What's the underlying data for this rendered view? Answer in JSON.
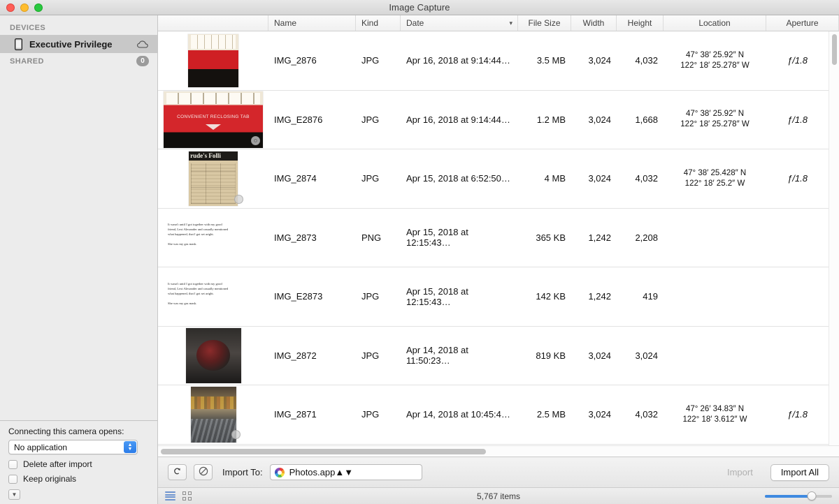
{
  "window": {
    "title": "Image Capture"
  },
  "sidebar": {
    "devices_header": "DEVICES",
    "devices": [
      {
        "label": "Executive Privilege",
        "icon": "iphone-icon",
        "trailing_icon": "cloud-icon",
        "selected": true
      }
    ],
    "shared_header": "SHARED",
    "shared_count": "0",
    "options": {
      "connect_label": "Connecting this camera opens:",
      "application_value": "No application",
      "delete_after_import": "Delete after import",
      "keep_originals": "Keep originals"
    }
  },
  "table": {
    "columns": [
      {
        "key": "thumb",
        "label": ""
      },
      {
        "key": "name",
        "label": "Name"
      },
      {
        "key": "kind",
        "label": "Kind"
      },
      {
        "key": "date",
        "label": "Date",
        "sort": "descending",
        "sort_icon": "chevron-down-icon"
      },
      {
        "key": "filesize",
        "label": "File Size"
      },
      {
        "key": "width",
        "label": "Width"
      },
      {
        "key": "height",
        "label": "Height"
      },
      {
        "key": "location",
        "label": "Location"
      },
      {
        "key": "aperture",
        "label": "Aperture"
      }
    ],
    "rows": [
      {
        "name": "IMG_2876",
        "kind": "JPG",
        "date": "Apr 16, 2018 at 9:14:44…",
        "filesize": "3.5 MB",
        "width": "3,024",
        "height": "4,032",
        "location_lat": "47° 38′ 25.92″ N",
        "location_lon": "122° 18′ 25.278″ W",
        "aperture": "ƒ/1.8",
        "thumb": "box-red-tall"
      },
      {
        "name": "IMG_E2876",
        "kind": "JPG",
        "date": "Apr 16, 2018 at 9:14:44…",
        "filesize": "1.2 MB",
        "width": "3,024",
        "height": "1,668",
        "location_lat": "47° 38′ 25.92″ N",
        "location_lon": "122° 18′ 25.278″ W",
        "aperture": "ƒ/1.8",
        "thumb": "box-red-wide",
        "thumb_caption": "CONVENIENT RECLOSING TAB",
        "edited_badge": true
      },
      {
        "name": "IMG_2874",
        "kind": "JPG",
        "date": "Apr 15, 2018 at 6:52:50…",
        "filesize": "4 MB",
        "width": "3,024",
        "height": "4,032",
        "location_lat": "47° 38′ 25.428″ N",
        "location_lon": "122° 18′ 25.2″ W",
        "aperture": "ƒ/1.8",
        "thumb": "comic-newspaper",
        "thumb_caption": "rude's Folli",
        "edited_badge": true
      },
      {
        "name": "IMG_2873",
        "kind": "PNG",
        "date": "Apr 15, 2018 at 12:15:43…",
        "filesize": "365 KB",
        "width": "1,242",
        "height": "2,208",
        "location_lat": "",
        "location_lon": "",
        "aperture": "",
        "thumb": "text-screenshot",
        "thumb_text_1": "It wasn't until I got together with my good",
        "thumb_text_2": "friend, Lexi Alexander and casually mentioned",
        "thumb_text_3": "what happened, that I got set aright.",
        "thumb_text_4": "She was my gas mask."
      },
      {
        "name": "IMG_E2873",
        "kind": "JPG",
        "date": "Apr 15, 2018 at 12:15:43…",
        "filesize": "142 KB",
        "width": "1,242",
        "height": "419",
        "location_lat": "",
        "location_lon": "",
        "aperture": "",
        "thumb": "text-screenshot",
        "thumb_text_1": "It wasn't until I got together with my good",
        "thumb_text_2": "friend, Lexi Alexander and casually mentioned",
        "thumb_text_3": "what happened, that I got set aright.",
        "thumb_text_4": "She was my gas mask."
      },
      {
        "name": "IMG_2872",
        "kind": "JPG",
        "date": "Apr 14, 2018 at 11:50:23…",
        "filesize": "819 KB",
        "width": "3,024",
        "height": "3,024",
        "location_lat": "",
        "location_lon": "",
        "aperture": "",
        "thumb": "gas-mask-photo"
      },
      {
        "name": "IMG_2871",
        "kind": "JPG",
        "date": "Apr 14, 2018 at 10:45:4…",
        "filesize": "2.5 MB",
        "width": "3,024",
        "height": "4,032",
        "location_lat": "47° 26′ 34.83″ N",
        "location_lon": "122° 18′ 3.612″ W",
        "aperture": "ƒ/1.8",
        "thumb": "escalator-photo",
        "edited_badge": true
      }
    ]
  },
  "toolbar": {
    "rotate_icon": "rotate-counterclockwise-icon",
    "delete_icon": "no-entry-icon",
    "import_to_label": "Import To:",
    "import_to_value": "Photos.app",
    "import_to_app_icon": "photos-app-icon",
    "import_label": "Import",
    "import_all_label": "Import All"
  },
  "statusbar": {
    "list_view_icon": "list-view-icon",
    "grid_view_icon": "grid-view-icon",
    "items_count": "5,767 items",
    "zoom_slider_value": 70
  }
}
